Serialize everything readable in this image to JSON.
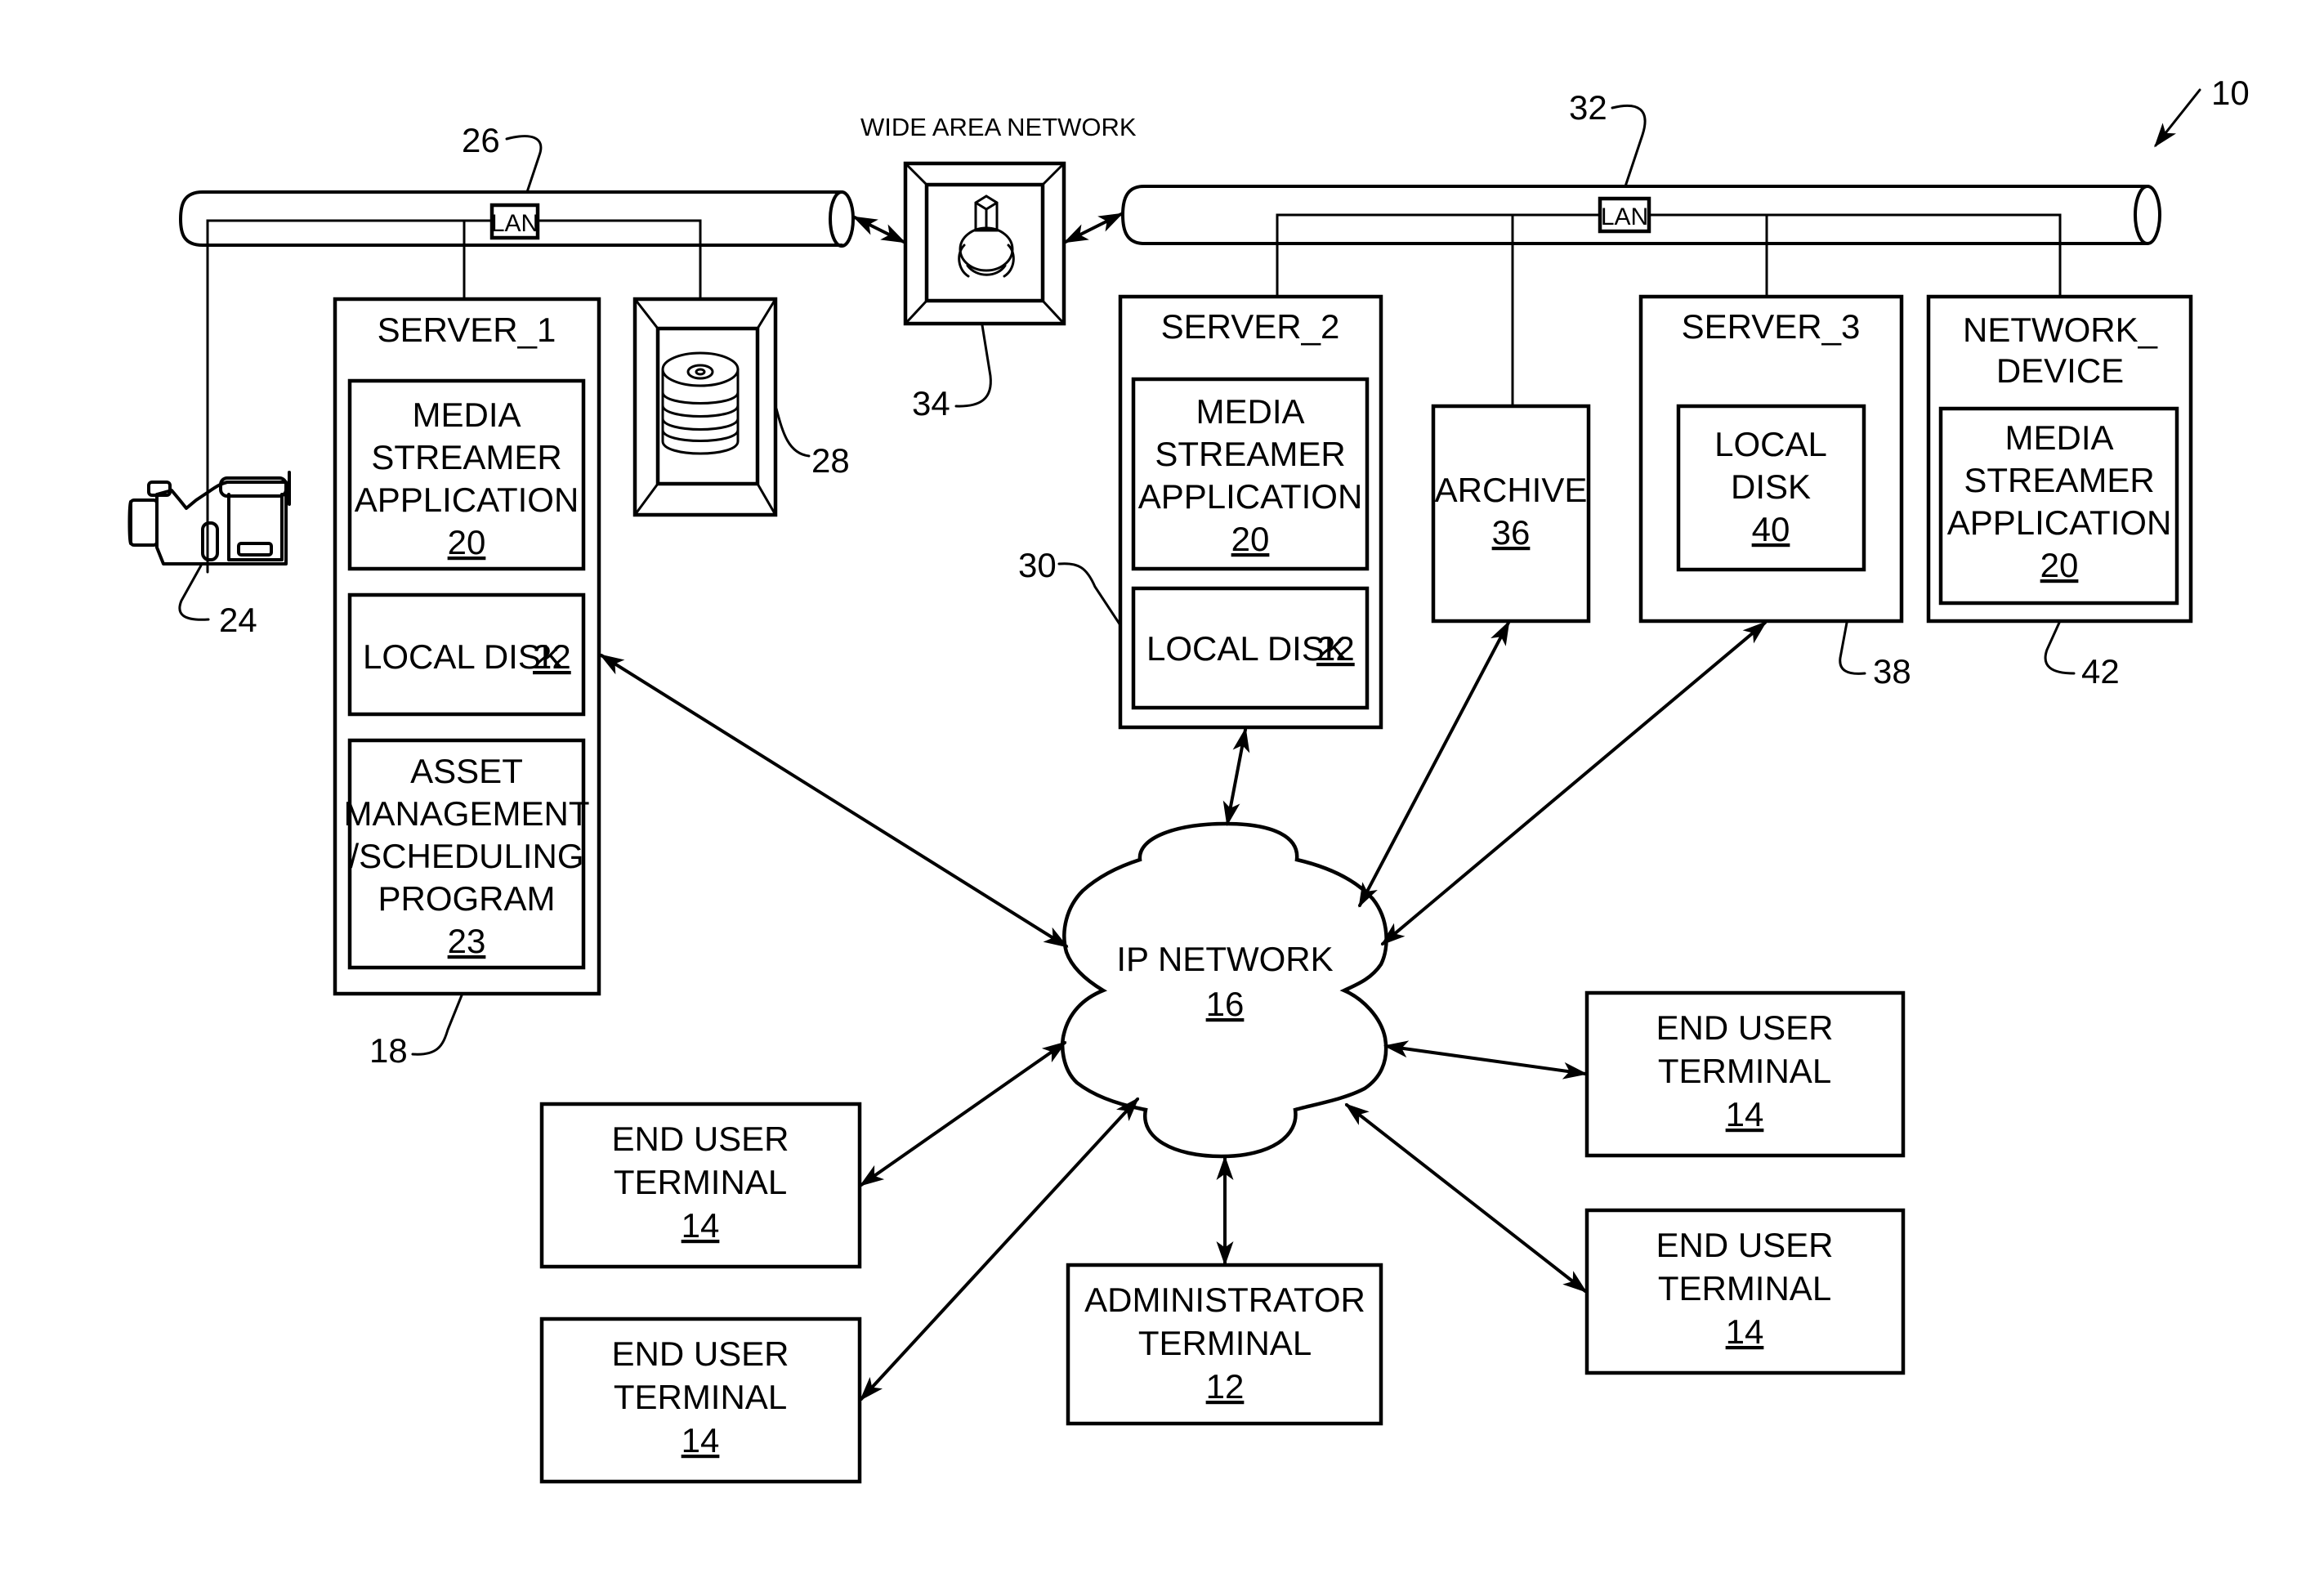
{
  "figure": {
    "reference_numeral": "10",
    "wan": {
      "title": "WIDE AREA NETWORK",
      "ref": "34"
    },
    "lan_left": {
      "badge": "LAN",
      "ref": "26"
    },
    "lan_right": {
      "badge": "LAN",
      "ref": "32"
    },
    "camera": {
      "icon": "video-camera-icon",
      "ref": "24"
    },
    "disk_storage": {
      "icon": "disk-stack-icon",
      "ref": "28"
    },
    "server_1": {
      "title": "SERVER_1",
      "ref": "18",
      "components": [
        {
          "lines": [
            "MEDIA",
            "STREAMER",
            "APPLICATION"
          ],
          "num": "20"
        },
        {
          "lines": [
            "LOCAL DISK"
          ],
          "num": "22"
        },
        {
          "lines": [
            "ASSET",
            "MANAGEMENT",
            "/SCHEDULING",
            "PROGRAM"
          ],
          "num": "23"
        }
      ]
    },
    "server_2": {
      "title": "SERVER_2",
      "ref": "30",
      "components": [
        {
          "lines": [
            "MEDIA",
            "STREAMER",
            "APPLICATION"
          ],
          "num": "20"
        },
        {
          "lines": [
            "LOCAL DISK"
          ],
          "num": "22"
        }
      ]
    },
    "archive": {
      "lines": [
        "ARCHIVE"
      ],
      "num": "36"
    },
    "server_3": {
      "title": "SERVER_3",
      "ref": "38",
      "components": [
        {
          "lines": [
            "LOCAL",
            "DISK"
          ],
          "num": "40"
        }
      ]
    },
    "network_device": {
      "title_lines": [
        "NETWORK_",
        "DEVICE"
      ],
      "ref": "42",
      "components": [
        {
          "lines": [
            "MEDIA",
            "STREAMER",
            "APPLICATION"
          ],
          "num": "20"
        }
      ]
    },
    "ip_network": {
      "lines": [
        "IP NETWORK"
      ],
      "num": "16"
    },
    "admin_terminal": {
      "lines": [
        "ADMINISTRATOR",
        "TERMINAL"
      ],
      "num": "12"
    },
    "end_user_terminals": [
      {
        "lines": [
          "END USER",
          "TERMINAL"
        ],
        "num": "14"
      },
      {
        "lines": [
          "END USER",
          "TERMINAL"
        ],
        "num": "14"
      },
      {
        "lines": [
          "END USER",
          "TERMINAL"
        ],
        "num": "14"
      },
      {
        "lines": [
          "END USER",
          "TERMINAL"
        ],
        "num": "14"
      }
    ]
  },
  "colors": {
    "ink": "#000000",
    "paper": "#ffffff"
  }
}
